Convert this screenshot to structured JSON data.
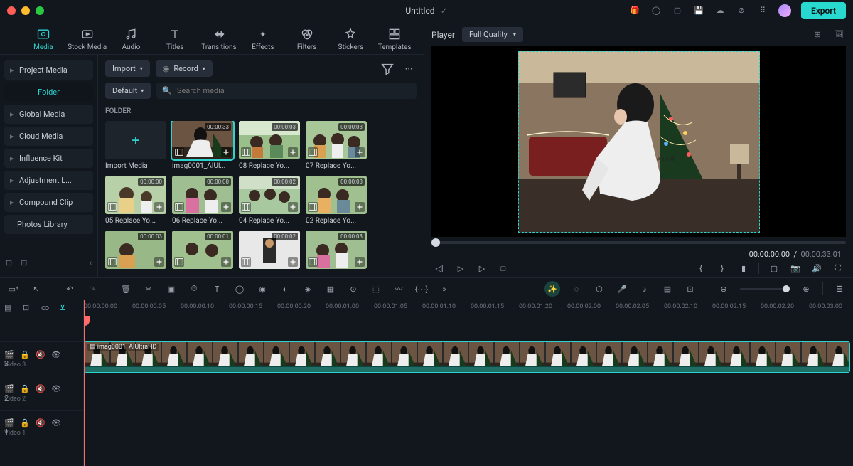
{
  "title": "Untitled",
  "export_label": "Export",
  "tabs": {
    "media": "Media",
    "stock": "Stock Media",
    "audio": "Audio",
    "titles": "Titles",
    "transitions": "Transitions",
    "effects": "Effects",
    "filters": "Filters",
    "stickers": "Stickers",
    "templates": "Templates"
  },
  "sidebar": {
    "items": [
      "Project Media",
      "Folder",
      "Global Media",
      "Cloud Media",
      "Influence Kit",
      "Adjustment L...",
      "Compound Clip",
      "Photos Library"
    ]
  },
  "controls": {
    "import": "Import",
    "record": "Record",
    "sort": "Default",
    "search_ph": "Search media"
  },
  "folder_header": "FOLDER",
  "import_label": "Import Media",
  "clips": [
    {
      "name": "imag0001_AIUl...",
      "dur": "00:00:33",
      "sel": true
    },
    {
      "name": "08 Replace Yo...",
      "dur": "00:00:03"
    },
    {
      "name": "07 Replace Yo...",
      "dur": "00:00:03"
    },
    {
      "name": "05 Replace Yo...",
      "dur": "00:00:00"
    },
    {
      "name": "06 Replace Yo...",
      "dur": "00:00:00"
    },
    {
      "name": "04 Replace Yo...",
      "dur": "00:00:02"
    },
    {
      "name": "02 Replace Yo...",
      "dur": "00:00:03"
    },
    {
      "name": "",
      "dur": "00:00:03"
    },
    {
      "name": "",
      "dur": "00:00:01"
    },
    {
      "name": "",
      "dur": "00:00:02"
    },
    {
      "name": "",
      "dur": "00:00:03"
    }
  ],
  "preview": {
    "label": "Player",
    "quality": "Full Quality",
    "cur": "00:00:00:00",
    "tot": "00:00:33:01"
  },
  "ruler": [
    "00:00:00:00",
    "00:00:00:05",
    "00:00:00:10",
    "00:00:00:15",
    "00:00:00:20",
    "00:00:01:00",
    "00:00:01:05",
    "00:00:01:10",
    "00:00:01:15",
    "00:00:01:20",
    "00:00:02:00",
    "00:00:02:05",
    "00:00:02:10",
    "00:00:02:15",
    "00:00:02:20",
    "00:00:03:00"
  ],
  "tracks": [
    {
      "icon": "🎬3",
      "name": "Video 3"
    },
    {
      "icon": "🎬2",
      "name": "Video 2"
    },
    {
      "icon": "🎬1",
      "name": "Video 1"
    }
  ],
  "timeline_clip": "imag0001_AIUltraHD"
}
